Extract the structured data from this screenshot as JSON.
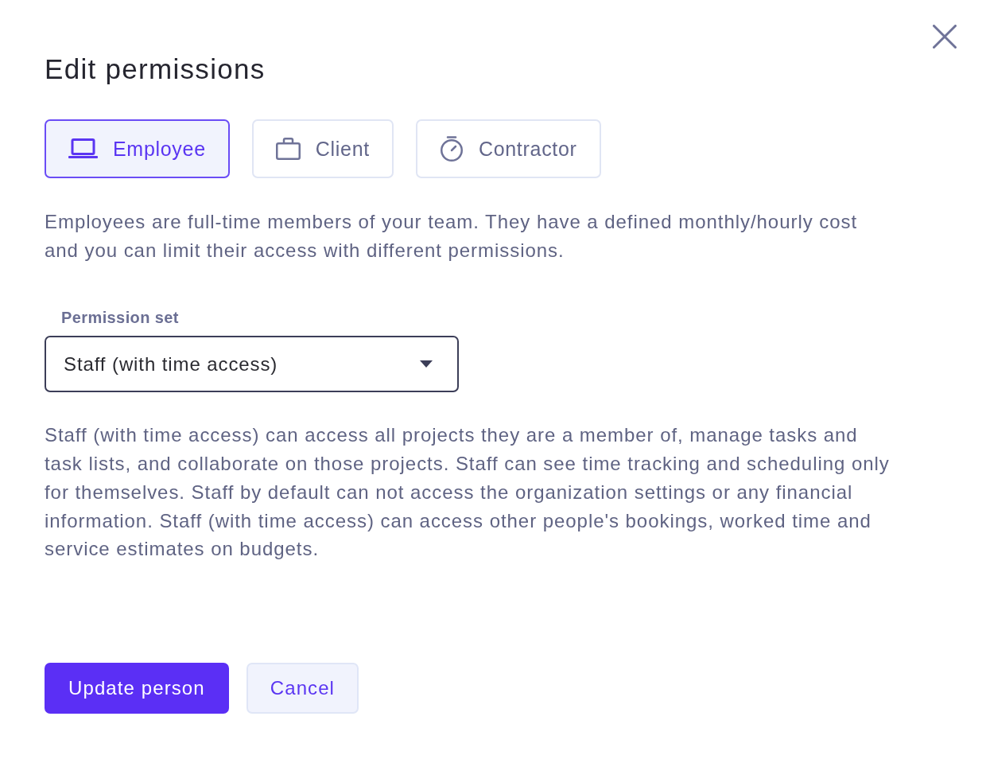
{
  "dialog": {
    "title": "Edit permissions"
  },
  "role_tabs": [
    {
      "label": "Employee",
      "selected": true
    },
    {
      "label": "Client",
      "selected": false
    },
    {
      "label": "Contractor",
      "selected": false
    }
  ],
  "role_description": "Employees are full-time members of your team. They have a defined monthly/hourly cost and you can limit their access with different permissions.",
  "permission_set": {
    "label": "Permission set",
    "value": "Staff (with time access)"
  },
  "permission_description": "Staff (with time access) can access all projects they are a member of, manage tasks and task lists, and collaborate on those projects. Staff can see time tracking and scheduling only for themselves. Staff by default can not access the organization settings or any financial information. Staff (with time access) can access other people's bookings, worked time and service estimates on budgets.",
  "buttons": [
    {
      "label": "Update person",
      "kind": "primary"
    },
    {
      "label": "Cancel",
      "kind": "secondary"
    }
  ]
}
